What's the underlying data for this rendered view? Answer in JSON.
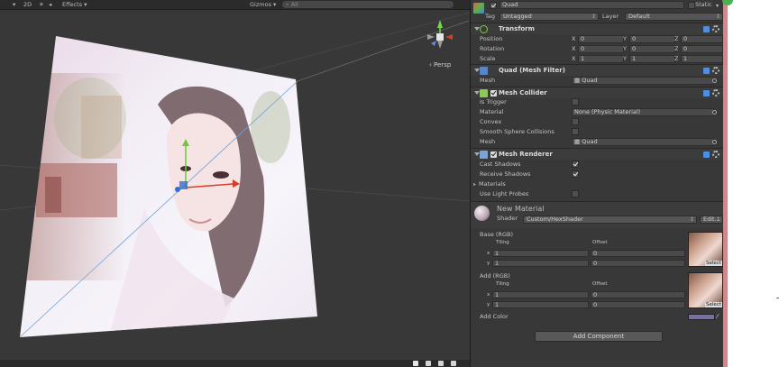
{
  "scene": {
    "toolbar": {
      "mode_2d": "2D",
      "effects": "Effects",
      "gizmos": "Gizmos",
      "search": "All"
    },
    "gizmo_label": "Persp"
  },
  "inspector": {
    "object_name": "Quad",
    "static_label": "Static",
    "tag_label": "Tag",
    "tag_value": "Untagged",
    "layer_label": "Layer",
    "layer_value": "Default",
    "transform": {
      "title": "Transform",
      "rows": [
        {
          "label": "Position",
          "x": "0",
          "y": "0",
          "z": "0"
        },
        {
          "label": "Rotation",
          "x": "0",
          "y": "0",
          "z": "0"
        },
        {
          "label": "Scale",
          "x": "1",
          "y": "1",
          "z": "1"
        }
      ],
      "axis": {
        "x": "X",
        "y": "Y",
        "z": "Z"
      }
    },
    "mesh_filter": {
      "title": "Quad (Mesh Filter)",
      "mesh_label": "Mesh",
      "mesh_value": "Quad"
    },
    "mesh_collider": {
      "title": "Mesh Collider",
      "is_trigger": "Is Trigger",
      "material_label": "Material",
      "material_value": "None (Physic Material)",
      "convex": "Convex",
      "smooth": "Smooth Sphere Collisions",
      "mesh_label": "Mesh",
      "mesh_value": "Quad"
    },
    "mesh_renderer": {
      "title": "Mesh Renderer",
      "cast_shadows": "Cast Shadows",
      "receive_shadows": "Receive Shadows",
      "materials": "Materials",
      "use_light_probes": "Use Light Probes"
    },
    "material": {
      "name": "New Material",
      "shader_label": "Shader",
      "shader_value": "Custom/HexShader",
      "edit": "Edit...",
      "base": {
        "title": "Base (RGB)",
        "tiling": "Tiling",
        "offset": "Offset",
        "x_label": "x",
        "y_label": "y",
        "tiling_x": "1",
        "tiling_y": "1",
        "offset_x": "0",
        "offset_y": "0",
        "select": "Select"
      },
      "add": {
        "title": "Add (RGB)",
        "tiling": "Tiling",
        "offset": "Offset",
        "x_label": "x",
        "y_label": "y",
        "tiling_x": "1",
        "tiling_y": "1",
        "offset_x": "0",
        "offset_y": "0",
        "select": "Select"
      },
      "add_color_label": "Add Color",
      "add_color": "#7a6ea8"
    },
    "add_component": "Add Component"
  }
}
